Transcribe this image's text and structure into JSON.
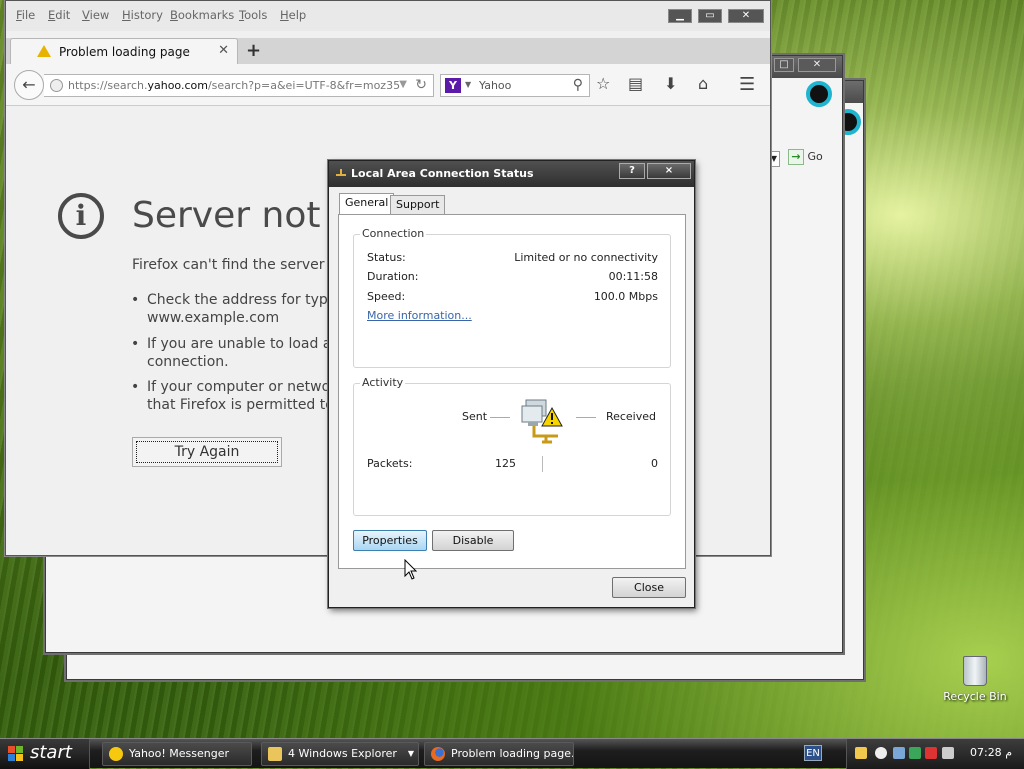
{
  "firefox": {
    "menu": [
      "File",
      "Edit",
      "View",
      "History",
      "Bookmarks",
      "Tools",
      "Help"
    ],
    "tab_title": "Problem loading page",
    "url_prefix": "https://search.",
    "url_domain": "yahoo.com",
    "url_suffix": "/search?p=a&ei=UTF-8&fr=moz35",
    "search_engine": "Yahoo",
    "error_title": "Server not f",
    "error_desc": "Firefox can't find the server at",
    "bullets": [
      {
        "line1": "Check the address for typin",
        "line2": "www.example.com"
      },
      {
        "line1": "If you are unable to load any",
        "line2": "connection."
      },
      {
        "line1": "If your computer or network",
        "line2": "that Firefox is permitted to a"
      }
    ],
    "try_again": "Try Again"
  },
  "bg_explorer": {
    "go_label": "Go"
  },
  "dialog": {
    "title": "Local Area Connection Status",
    "help_btn": "?",
    "close_btn": "×",
    "tabs": [
      "General",
      "Support"
    ],
    "connection": {
      "label": "Connection",
      "status_label": "Status:",
      "status_value": "Limited or no connectivity",
      "duration_label": "Duration:",
      "duration_value": "00:11:58",
      "speed_label": "Speed:",
      "speed_value": "100.0 Mbps",
      "more_info": "More information..."
    },
    "activity": {
      "label": "Activity",
      "sent_label": "Sent",
      "received_label": "Received",
      "packets_label": "Packets:",
      "packets_sent": "125",
      "packets_received": "0"
    },
    "properties_btn": "Properties",
    "disable_btn": "Disable",
    "close_label": "Close"
  },
  "taskbar": {
    "start": "start",
    "items": [
      "Yahoo! Messenger",
      "4 Windows Explorer",
      "Problem loading page..."
    ],
    "lang": "EN",
    "clock": "07:28 م"
  },
  "desktop": {
    "recycle_bin": "Recycle Bin"
  }
}
